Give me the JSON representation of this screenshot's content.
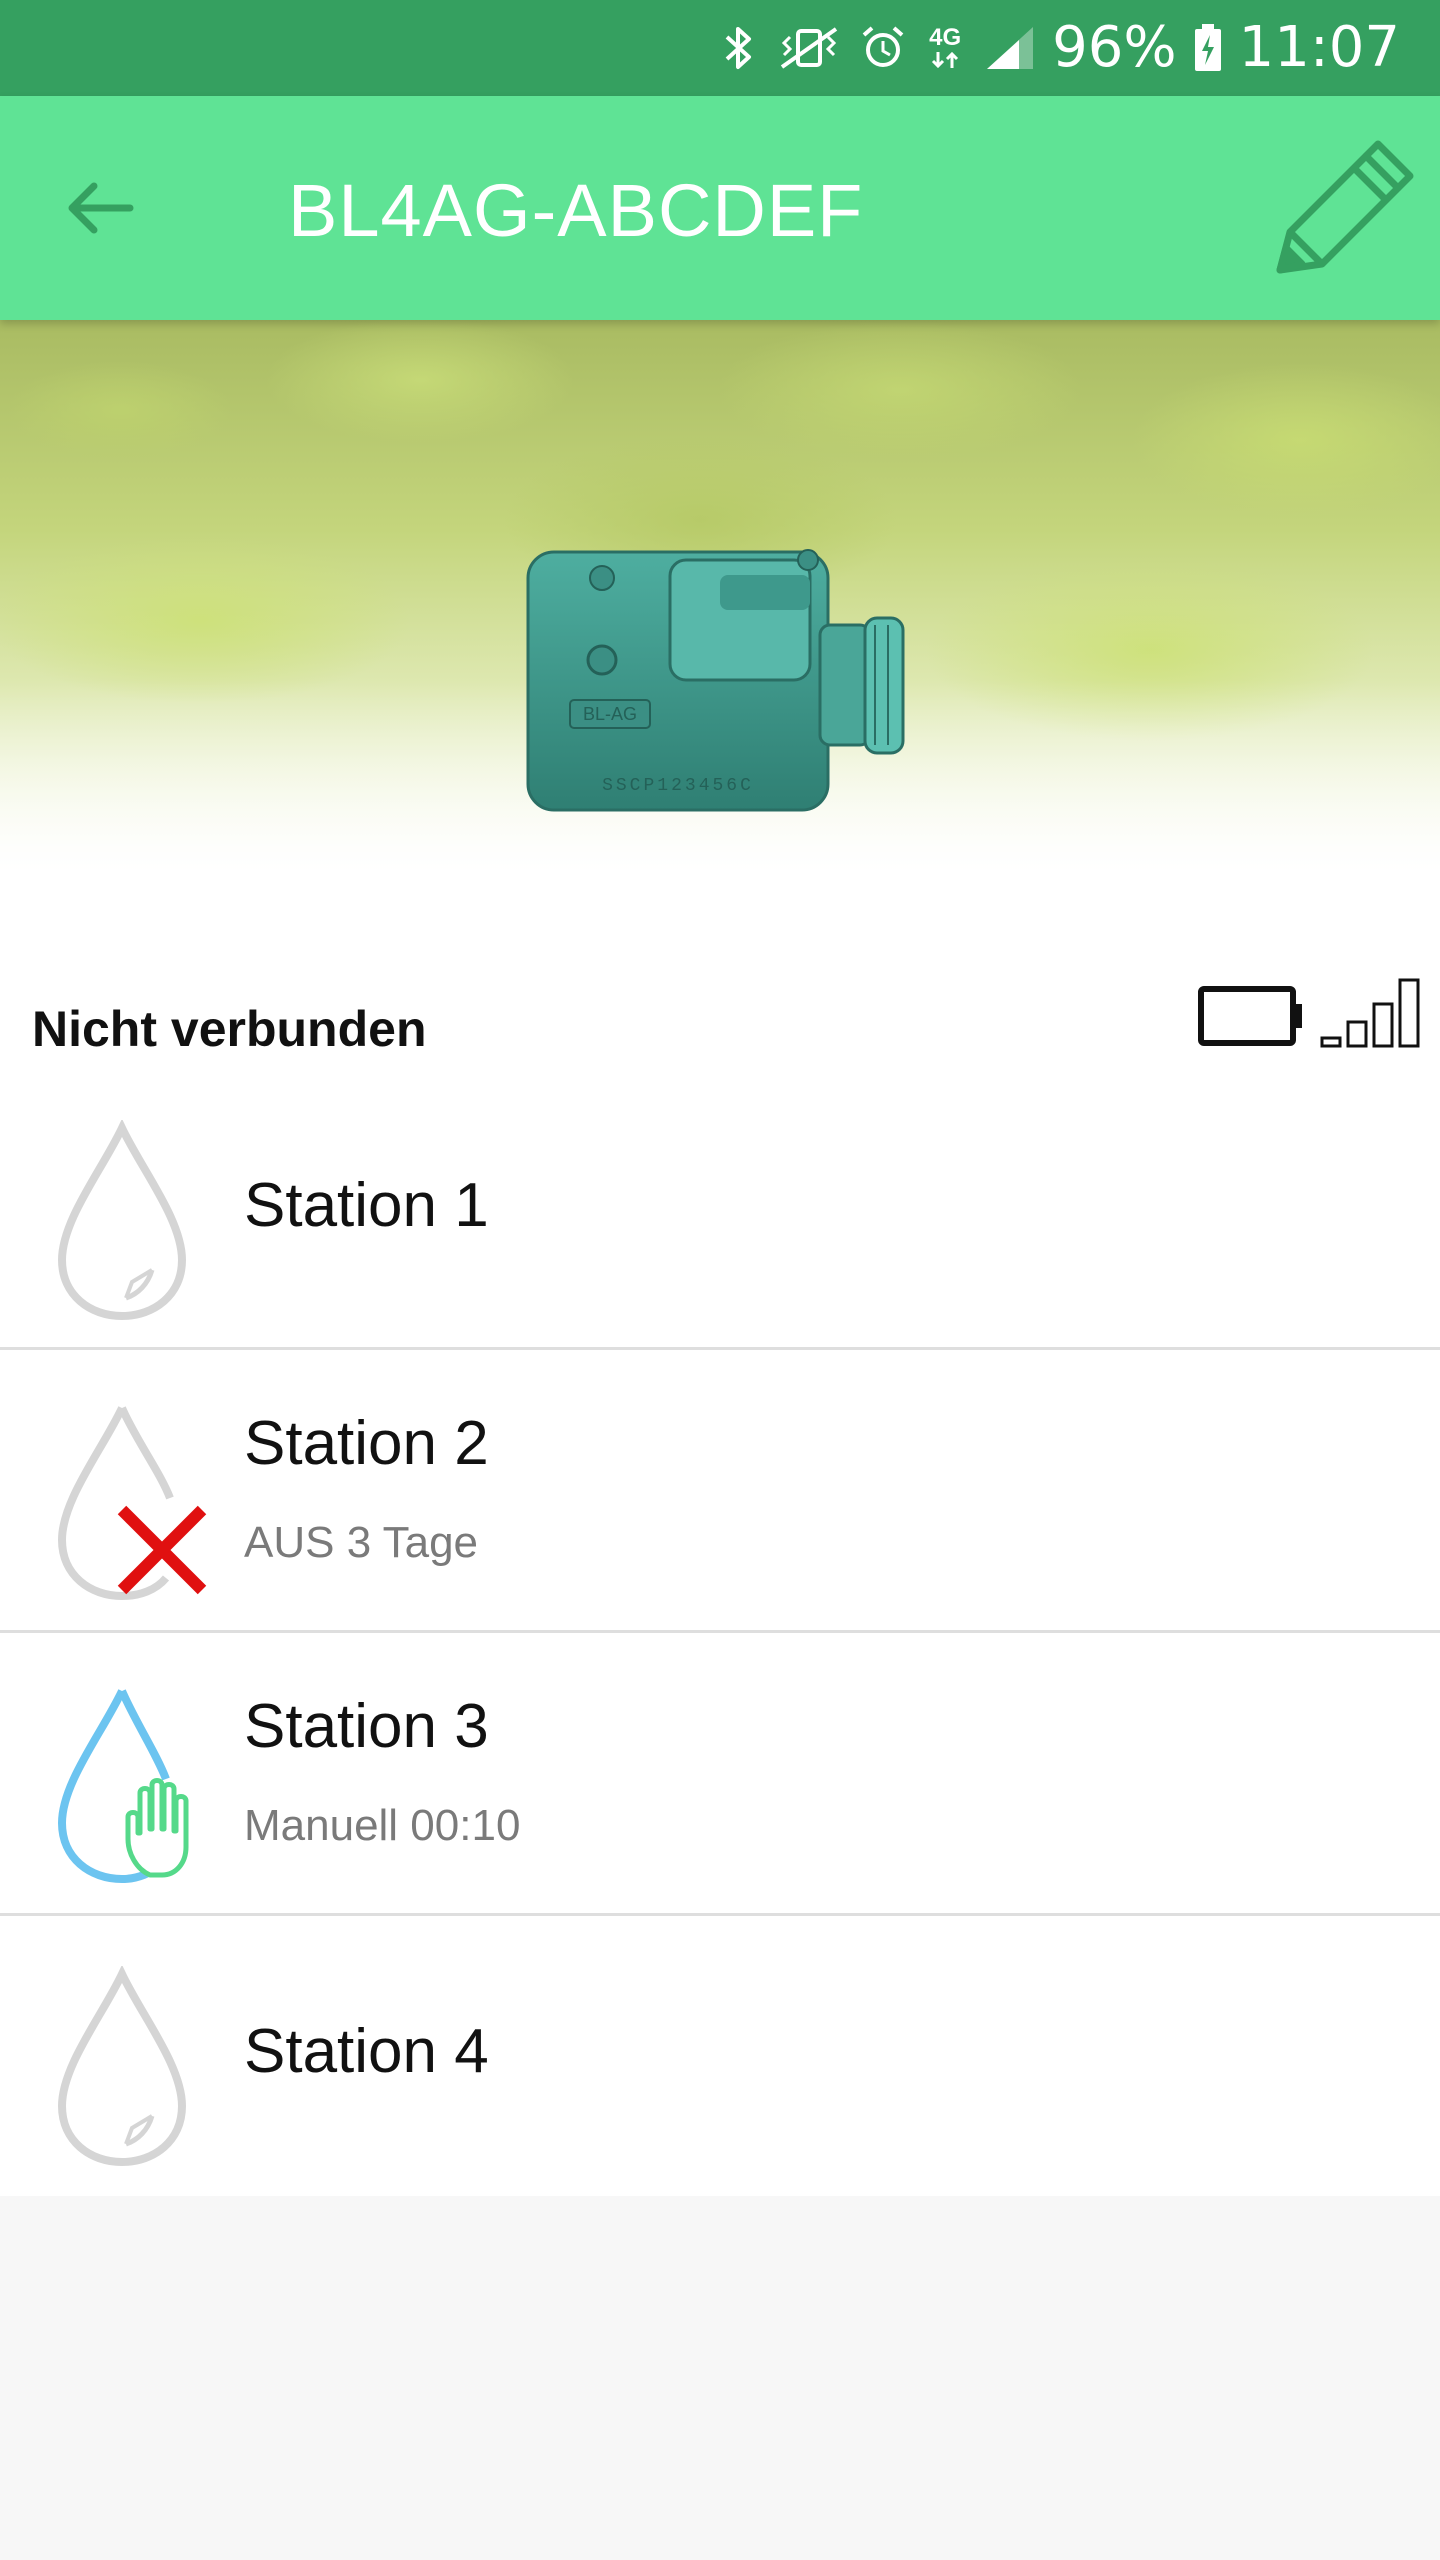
{
  "status_bar": {
    "icons": [
      "bluetooth-icon",
      "vibrate-mute-icon",
      "alarm-icon",
      "4g-icon",
      "cell-signal-icon",
      "battery-charging-icon"
    ],
    "network": "4G",
    "battery": "96%",
    "time": "11:07",
    "color": "#35a060"
  },
  "app_bar": {
    "title": "BL4AG-ABCDEF",
    "back_icon": "arrow-left-icon",
    "edit_icon": "pencil-icon",
    "color": "#5fe395"
  },
  "hero": {
    "device_label": "BL-AG",
    "serial": "SSCP123456C"
  },
  "connection": {
    "status": "Nicht verbunden",
    "battery_icon": "battery-empty-icon",
    "signal_icon": "signal-bars-icon"
  },
  "stations": [
    {
      "name": "Station 1",
      "subtitle": "",
      "icon": "water-drop-icon",
      "state": "inactive"
    },
    {
      "name": "Station 2",
      "subtitle": "AUS 3 Tage",
      "icon": "water-drop-off-icon",
      "state": "off"
    },
    {
      "name": "Station 3",
      "subtitle": "Manuell 00:10",
      "icon": "water-drop-manual-icon",
      "state": "manual"
    },
    {
      "name": "Station 4",
      "subtitle": "",
      "icon": "water-drop-icon",
      "state": "inactive"
    }
  ],
  "colors": {
    "accent": "#5fe395",
    "drop_inactive": "#d5d5d5",
    "drop_active": "#6cc4f0",
    "off_red": "#e01010",
    "manual_green": "#55d98a"
  }
}
